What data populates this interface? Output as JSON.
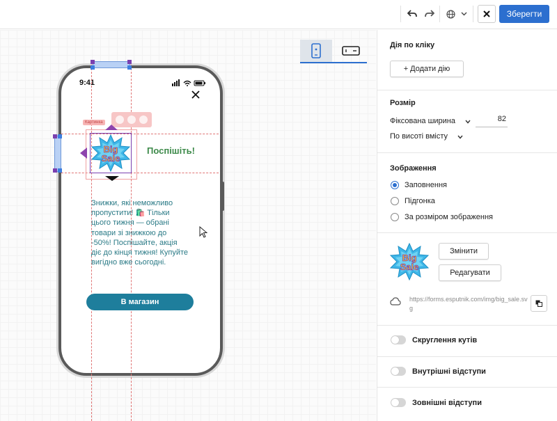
{
  "toolbar": {
    "save_label": "Зберегти",
    "undo_icon": "undo-icon",
    "redo_icon": "redo-icon",
    "language_icon": "globe-icon",
    "close_icon": "close-icon"
  },
  "canvas": {
    "status_time": "9:41",
    "selection_label": "Картинка",
    "hurry_text": "Поспішіть!",
    "image_text_line1": "Big",
    "image_text_line2": "Sale",
    "body_text": "Знижки, які неможливо пропустити! 🛍️ Тільки цього тижня — обрані товари зі знижкою до -50%! Поспішайте, акція діє до кінця тижня! Купуйте вигідно вже сьогодні.",
    "shop_button": "В магазин"
  },
  "panel": {
    "click_action": {
      "title": "Дія по кліку",
      "add_action": "+ Додати дію"
    },
    "size": {
      "title": "Розмір",
      "width_mode": "Фіксована ширина",
      "width_value": "82",
      "height_mode": "По висоті вмісту"
    },
    "image": {
      "title": "Зображення",
      "options": [
        "Заповнення",
        "Підгонка",
        "За розміром зображення"
      ],
      "selected": "Заповнення",
      "change_button": "Змінити",
      "edit_button": "Редагувати",
      "url": "https://forms.esputnik.com/img/big_sale.svg"
    },
    "toggles": [
      {
        "label": "Скруглення кутів",
        "on": false
      },
      {
        "label": "Внутрішні відступи",
        "on": false
      },
      {
        "label": "Зовнішні відступи",
        "on": false
      }
    ]
  },
  "colors": {
    "primary": "#2c6fcf",
    "shop_button": "#1e7e9c",
    "hurry_text": "#3d8a4a",
    "body_text": "#2a7a86",
    "guide": "#e07474",
    "selection": "#7a3fb0"
  }
}
